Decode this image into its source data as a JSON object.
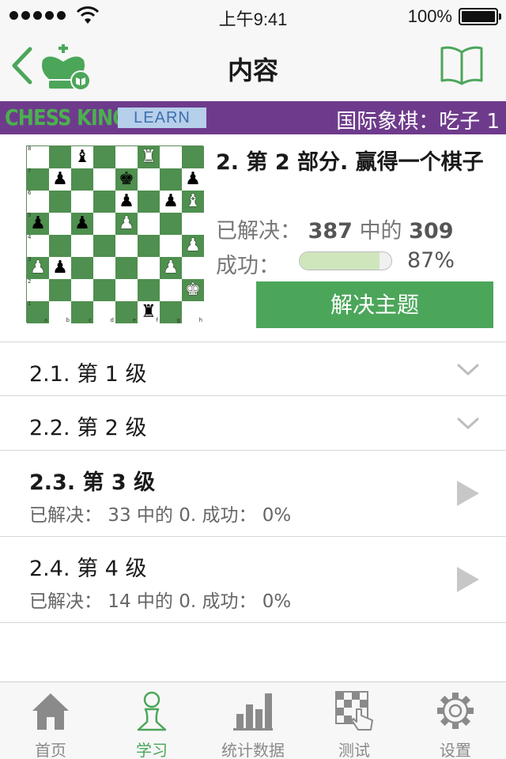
{
  "status_bar": {
    "time": "上午9:41",
    "battery": "100%"
  },
  "nav": {
    "title": "内容"
  },
  "banner": {
    "brand": "CHESS KING",
    "badge": "LEARN",
    "title": "国际象棋：吃子 1"
  },
  "colors": {
    "accent_green": "#4ca65a",
    "banner_purple": "#6e3b8c",
    "board_dark": "#4f8f4f"
  },
  "board": {
    "rank_labels": [
      "8",
      "7",
      "6",
      "5",
      "4",
      "3",
      "2",
      "1"
    ],
    "file_labels": [
      "a",
      "b",
      "c",
      "d",
      "e",
      "f",
      "g",
      "h"
    ],
    "rows": [
      [
        null,
        null,
        "bB",
        null,
        null,
        "wR",
        null,
        null
      ],
      [
        null,
        "bP",
        null,
        null,
        "bK",
        null,
        null,
        "bP"
      ],
      [
        null,
        null,
        null,
        null,
        "bP",
        null,
        "bP",
        "wB"
      ],
      [
        "bP",
        null,
        "bP",
        null,
        "wP",
        null,
        null,
        null
      ],
      [
        null,
        null,
        null,
        null,
        null,
        null,
        null,
        "wP"
      ],
      [
        "wP",
        "bP",
        null,
        null,
        null,
        null,
        "wP",
        null
      ],
      [
        null,
        null,
        null,
        null,
        null,
        null,
        null,
        "wK"
      ],
      [
        null,
        null,
        null,
        null,
        null,
        "bR",
        null,
        null
      ]
    ]
  },
  "summary": {
    "part_title": "2. 第 2 部分. 赢得一个棋子",
    "solved_label": "已解决：",
    "solved_total": "387",
    "solved_mid": "中的",
    "solved_count": "309",
    "success_label": "成功：",
    "success_pct": "87%",
    "success_value": 0.87,
    "solve_button": "解决主题"
  },
  "levels": [
    {
      "title": "2.1. 第 1 级",
      "bold": false,
      "subtitle": "",
      "icon": "chevron-down-icon"
    },
    {
      "title": "2.2. 第 2 级",
      "bold": false,
      "subtitle": "",
      "icon": "chevron-down-icon"
    },
    {
      "title": "2.3. 第 3 级",
      "bold": true,
      "subtitle": "已解决：  33 中的 0. 成功：  0%",
      "icon": "play-icon"
    },
    {
      "title": "2.4. 第 4 级",
      "bold": false,
      "subtitle": "已解决：  14 中的 0. 成功：  0%",
      "icon": "play-icon"
    }
  ],
  "tabs": [
    {
      "label": "首页",
      "icon": "home-icon",
      "active": false
    },
    {
      "label": "学习",
      "icon": "pawn-icon",
      "active": true
    },
    {
      "label": "统计数据",
      "icon": "bar-chart-icon",
      "active": false
    },
    {
      "label": "测试",
      "icon": "board-hand-icon",
      "active": false
    },
    {
      "label": "设置",
      "icon": "gear-icon",
      "active": false
    }
  ]
}
